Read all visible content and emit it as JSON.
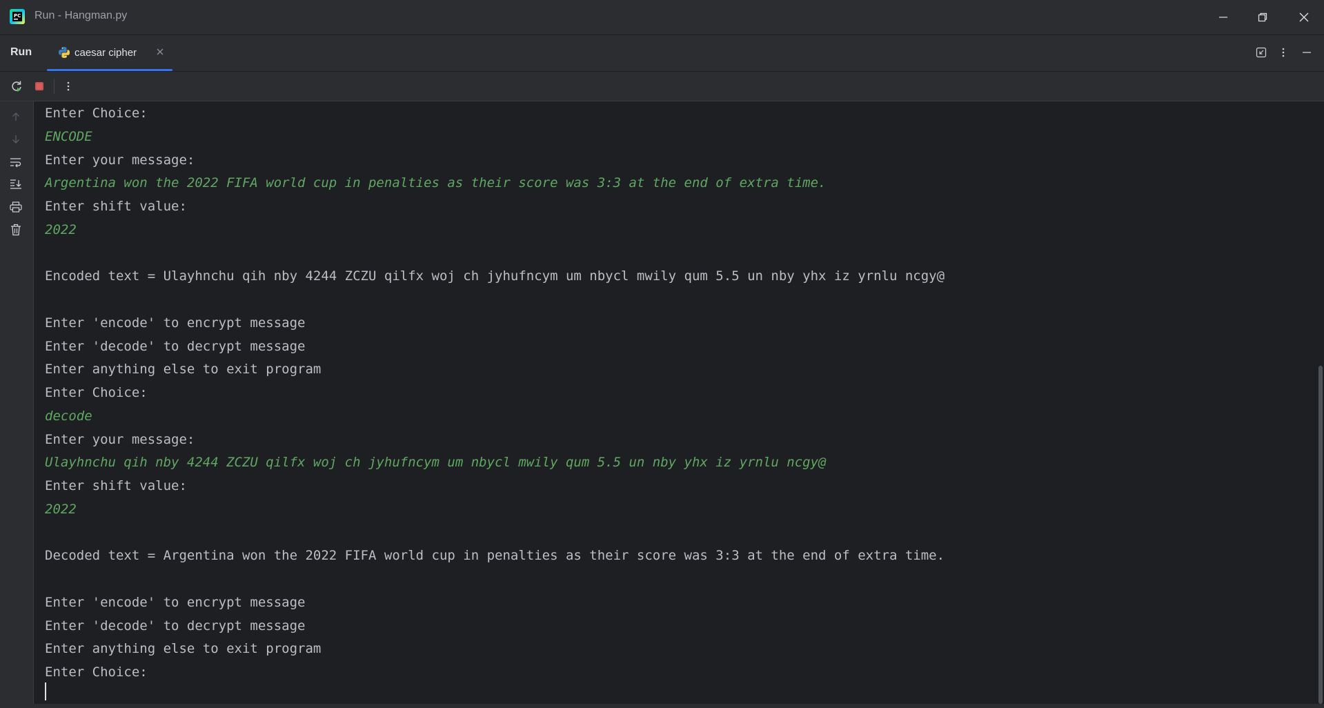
{
  "window": {
    "title": "Run - Hangman.py"
  },
  "tabbar": {
    "run_label": "Run",
    "tab_label": "caesar cipher",
    "accent": "#3574f0"
  },
  "colors": {
    "background": "#1e1f22",
    "panel": "#2b2d30",
    "output_text": "#bcbec4",
    "user_input_text": "#5fa862",
    "stop_icon": "#c75450"
  },
  "icons": {
    "app": "pycharm-icon",
    "tab": "python-icon",
    "toolbar": [
      "rerun-icon",
      "stop-icon",
      "more-vertical-icon"
    ],
    "gutter": [
      "up-arrow-icon",
      "down-arrow-icon",
      "soft-wrap-icon",
      "scroll-to-end-icon",
      "print-icon",
      "trash-icon"
    ],
    "tabbar_right": [
      "restore-layout-icon",
      "more-vertical-icon",
      "minimize-icon"
    ],
    "window": [
      "minimize-icon",
      "restore-icon",
      "close-icon"
    ]
  },
  "console": {
    "lines": [
      {
        "text": "Enter Choice:",
        "kind": "output"
      },
      {
        "text": "ENCODE",
        "kind": "input"
      },
      {
        "text": "Enter your message:",
        "kind": "output"
      },
      {
        "text": "Argentina won the 2022 FIFA world cup in penalties as their score was 3:3 at the end of extra time.",
        "kind": "input"
      },
      {
        "text": "Enter shift value:",
        "kind": "output"
      },
      {
        "text": "2022",
        "kind": "input"
      },
      {
        "text": "",
        "kind": "output"
      },
      {
        "text": "Encoded text = Ulayhnchu qih nby 4244 ZCZU qilfx woj ch jyhufncym um nbycl mwily qum 5.5 un nby yhx iz yrnlu ncgy@",
        "kind": "output"
      },
      {
        "text": "",
        "kind": "output"
      },
      {
        "text": "Enter 'encode' to encrypt message",
        "kind": "output"
      },
      {
        "text": "Enter 'decode' to decrypt message",
        "kind": "output"
      },
      {
        "text": "Enter anything else to exit program",
        "kind": "output"
      },
      {
        "text": "Enter Choice:",
        "kind": "output"
      },
      {
        "text": "decode",
        "kind": "input"
      },
      {
        "text": "Enter your message:",
        "kind": "output"
      },
      {
        "text": "Ulayhnchu qih nby 4244 ZCZU qilfx woj ch jyhufncym um nbycl mwily qum 5.5 un nby yhx iz yrnlu ncgy@",
        "kind": "input"
      },
      {
        "text": "Enter shift value:",
        "kind": "output"
      },
      {
        "text": "2022",
        "kind": "input"
      },
      {
        "text": "",
        "kind": "output"
      },
      {
        "text": "Decoded text = Argentina won the 2022 FIFA world cup in penalties as their score was 3:3 at the end of extra time.",
        "kind": "output"
      },
      {
        "text": "",
        "kind": "output"
      },
      {
        "text": "Enter 'encode' to encrypt message",
        "kind": "output"
      },
      {
        "text": "Enter 'decode' to decrypt message",
        "kind": "output"
      },
      {
        "text": "Enter anything else to exit program",
        "kind": "output"
      },
      {
        "text": "Enter Choice:",
        "kind": "output"
      }
    ]
  }
}
